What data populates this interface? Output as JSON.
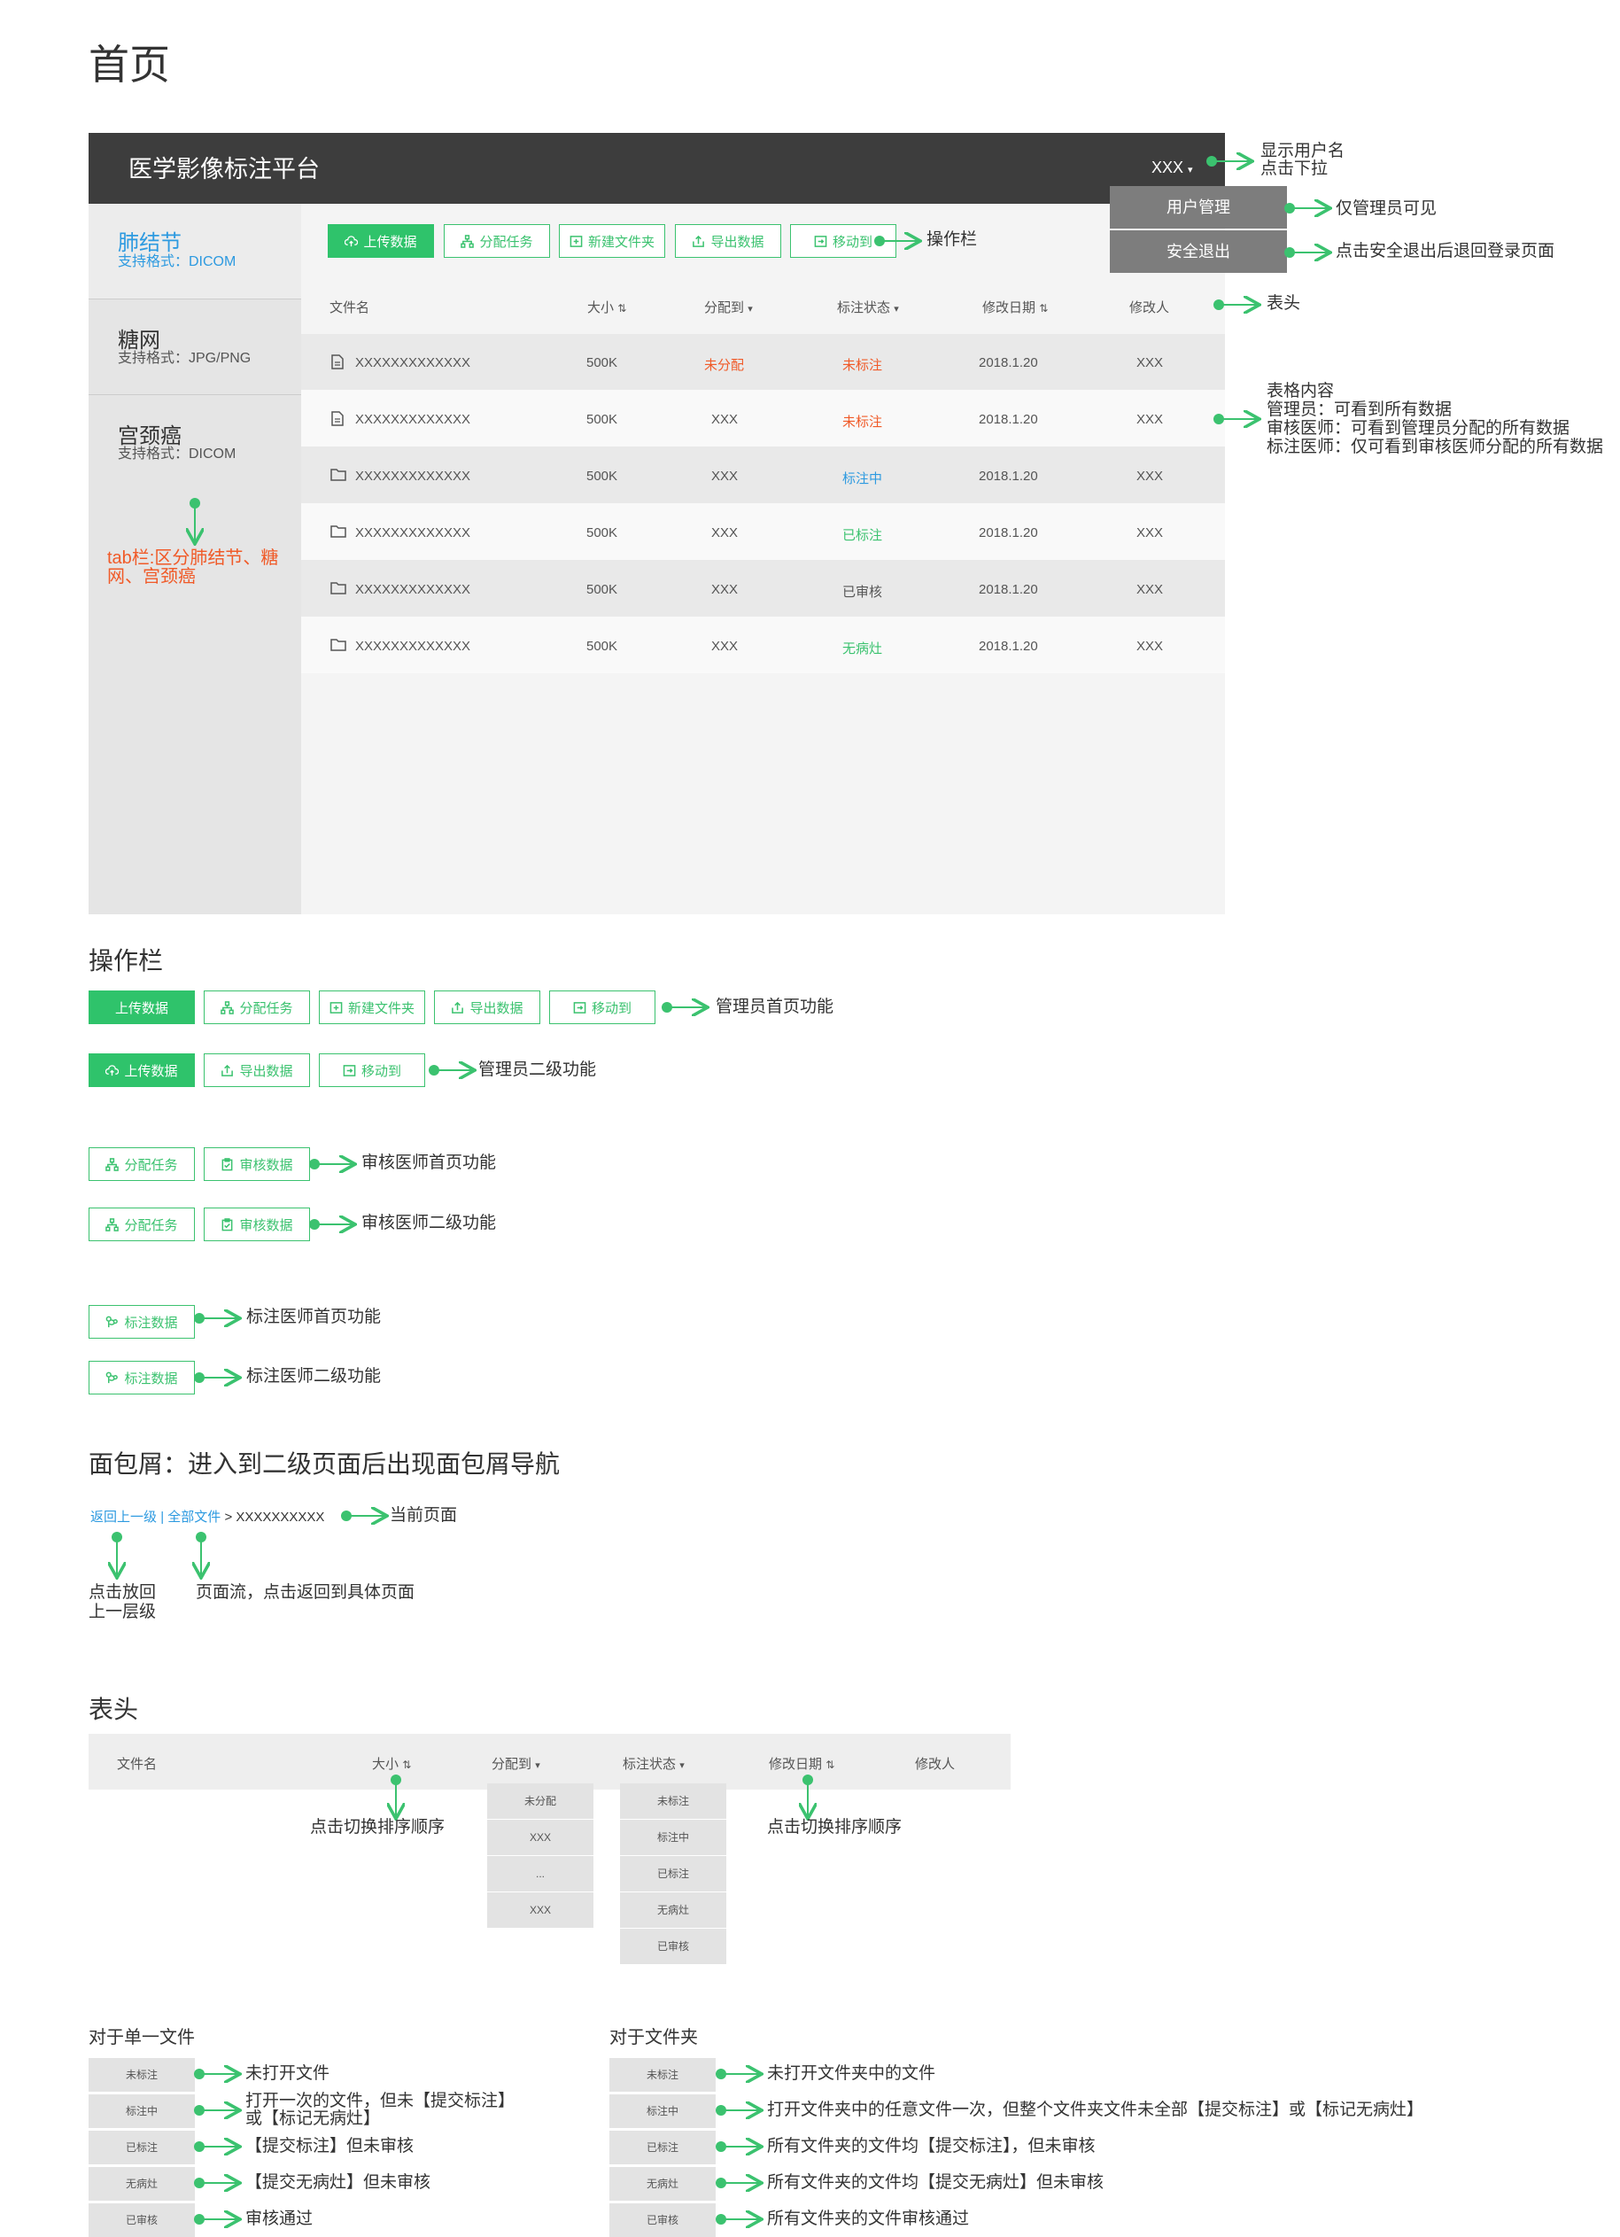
{
  "page_title": "首页",
  "app": {
    "title": "医学影像标注平台",
    "user": "XXX",
    "menu": [
      "用户管理",
      "安全退出"
    ]
  },
  "sidebar": {
    "items": [
      {
        "title": "肺结节",
        "sub": "支持格式：DICOM"
      },
      {
        "title": "糖网",
        "sub": "支持格式：JPG/PNG"
      },
      {
        "title": "宫颈癌",
        "sub": "支持格式：DICOM"
      }
    ],
    "note": "tab栏:区分肺结节、糖网、宫颈癌"
  },
  "toolbar": {
    "buttons": [
      "上传数据",
      "分配任务",
      "新建文件夹",
      "导出数据",
      "移动到"
    ]
  },
  "table": {
    "headers": [
      "文件名",
      "大小",
      "分配到",
      "标注状态",
      "修改日期",
      "修改人"
    ],
    "rows": [
      {
        "name": "XXXXXXXXXXXXX",
        "size": "500K",
        "assign": "未分配",
        "status": "未标注",
        "date": "2018.1.20",
        "user": "XXX"
      },
      {
        "name": "XXXXXXXXXXXXX",
        "size": "500K",
        "assign": "XXX",
        "status": "未标注",
        "date": "2018.1.20",
        "user": "XXX"
      },
      {
        "name": "XXXXXXXXXXXXX",
        "size": "500K",
        "assign": "XXX",
        "status": "标注中",
        "date": "2018.1.20",
        "user": "XXX"
      },
      {
        "name": "XXXXXXXXXXXXX",
        "size": "500K",
        "assign": "XXX",
        "status": "已标注",
        "date": "2018.1.20",
        "user": "XXX"
      },
      {
        "name": "XXXXXXXXXXXXX",
        "size": "500K",
        "assign": "XXX",
        "status": "已审核",
        "date": "2018.1.20",
        "user": "XXX"
      },
      {
        "name": "XXXXXXXXXXXXX",
        "size": "500K",
        "assign": "XXX",
        "status": "无病灶",
        "date": "2018.1.20",
        "user": "XXX"
      }
    ]
  },
  "annotations": {
    "username": [
      "显示用户名",
      "点击下拉"
    ],
    "admin_only": "仅管理员可见",
    "logout": "点击安全退出后退回登录页面",
    "toolbar": "操作栏",
    "header": "表头",
    "content": [
      "表格内容",
      "管理员：可看到所有数据",
      "审核医师：可看到管理员分配的所有数据",
      "标注医师：仅可看到审核医师分配的所有数据"
    ]
  },
  "ops_section": {
    "title": "操作栏",
    "admin_home": {
      "buttons": [
        "上传数据",
        "分配任务",
        "新建文件夹",
        "导出数据",
        "移动到"
      ],
      "label": "管理员首页功能"
    },
    "admin_sub": {
      "buttons": [
        "上传数据",
        "导出数据",
        "移动到"
      ],
      "label": "管理员二级功能"
    },
    "reviewer_home": {
      "buttons": [
        "分配任务",
        "审核数据"
      ],
      "label": "审核医师首页功能"
    },
    "reviewer_sub": {
      "buttons": [
        "分配任务",
        "审核数据"
      ],
      "label": "审核医师二级功能"
    },
    "labeler_home": {
      "buttons": [
        "标注数据"
      ],
      "label": "标注医师首页功能"
    },
    "labeler_sub": {
      "buttons": [
        "标注数据"
      ],
      "label": "标注医师二级功能"
    }
  },
  "breadcrumb_section": {
    "title": "面包屑：进入到二级页面后出现面包屑导航",
    "back": "返回上一级",
    "sep": "|",
    "all": "全部文件",
    "current": "> XXXXXXXXXX",
    "current_note": "当前页面",
    "back_note": [
      "点击放回",
      "上一层级"
    ],
    "all_note": "页面流，点击返回到具体页面"
  },
  "header_section": {
    "title": "表头",
    "headers": [
      "文件名",
      "大小",
      "分配到",
      "标注状态",
      "修改日期",
      "修改人"
    ],
    "assign_options": [
      "未分配",
      "XXX",
      "...",
      "XXX"
    ],
    "status_options": [
      "未标注",
      "标注中",
      "已标注",
      "无病灶",
      "已审核"
    ],
    "size_note": "点击切换排序顺序",
    "date_note": "点击切换排序顺序"
  },
  "single_file": {
    "title": "对于单一文件",
    "items": [
      {
        "status": "未标注",
        "desc": [
          "未打开文件"
        ]
      },
      {
        "status": "标注中",
        "desc": [
          "打开一次的文件，但未【提交标注】",
          "或【标记无病灶】"
        ]
      },
      {
        "status": "已标注",
        "desc": [
          "【提交标注】但未审核"
        ]
      },
      {
        "status": "无病灶",
        "desc": [
          "【提交无病灶】但未审核"
        ]
      },
      {
        "status": "已审核",
        "desc": [
          "审核通过"
        ]
      }
    ]
  },
  "folder": {
    "title": "对于文件夹",
    "items": [
      {
        "status": "未标注",
        "desc": "未打开文件夹中的文件"
      },
      {
        "status": "标注中",
        "desc": "打开文件夹中的任意文件一次，但整个文件夹文件未全部【提交标注】或【标记无病灶】"
      },
      {
        "status": "已标注",
        "desc": "所有文件夹的文件均【提交标注】，但未审核"
      },
      {
        "status": "无病灶",
        "desc": "所有文件夹的文件均【提交无病灶】但未审核"
      },
      {
        "status": "已审核",
        "desc": "所有文件夹的文件审核通过"
      }
    ]
  },
  "colors": {
    "accent": "#2fc36b",
    "header_bar": "#3d3d3d",
    "danger": "#f05a28",
    "info": "#2d9ae0"
  }
}
